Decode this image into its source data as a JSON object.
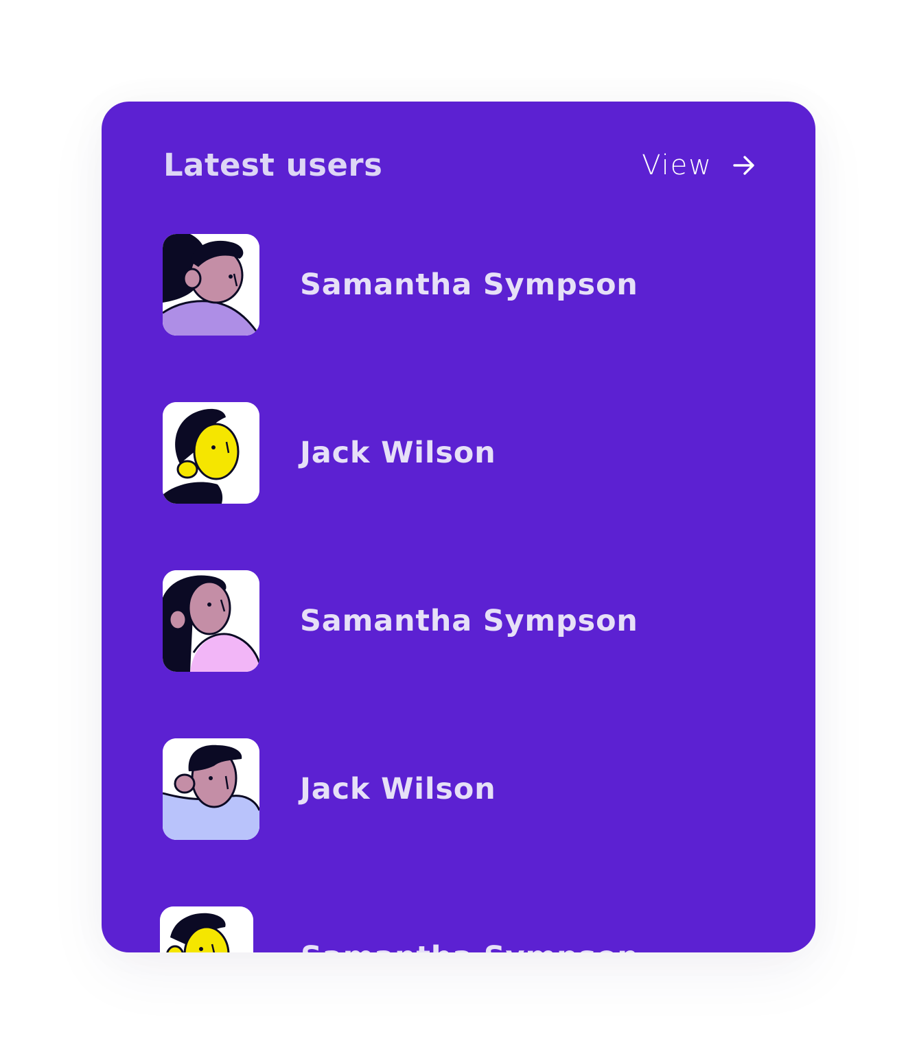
{
  "header": {
    "title": "Latest users",
    "view_label": "View"
  },
  "colors": {
    "card_background": "#5c21d2",
    "text_primary": "#e6e0f7"
  },
  "users": [
    {
      "name": "Samantha Sympson",
      "avatar": "woman-long-hair-avatar-icon"
    },
    {
      "name": "Jack Wilson",
      "avatar": "man-yellow-face-avatar-icon"
    },
    {
      "name": "Samantha Sympson",
      "avatar": "woman-pink-top-avatar-icon"
    },
    {
      "name": "Jack Wilson",
      "avatar": "man-blue-shirt-avatar-icon"
    },
    {
      "name": "Samantha Sympson",
      "avatar": "yellow-face-avatar-icon"
    }
  ]
}
